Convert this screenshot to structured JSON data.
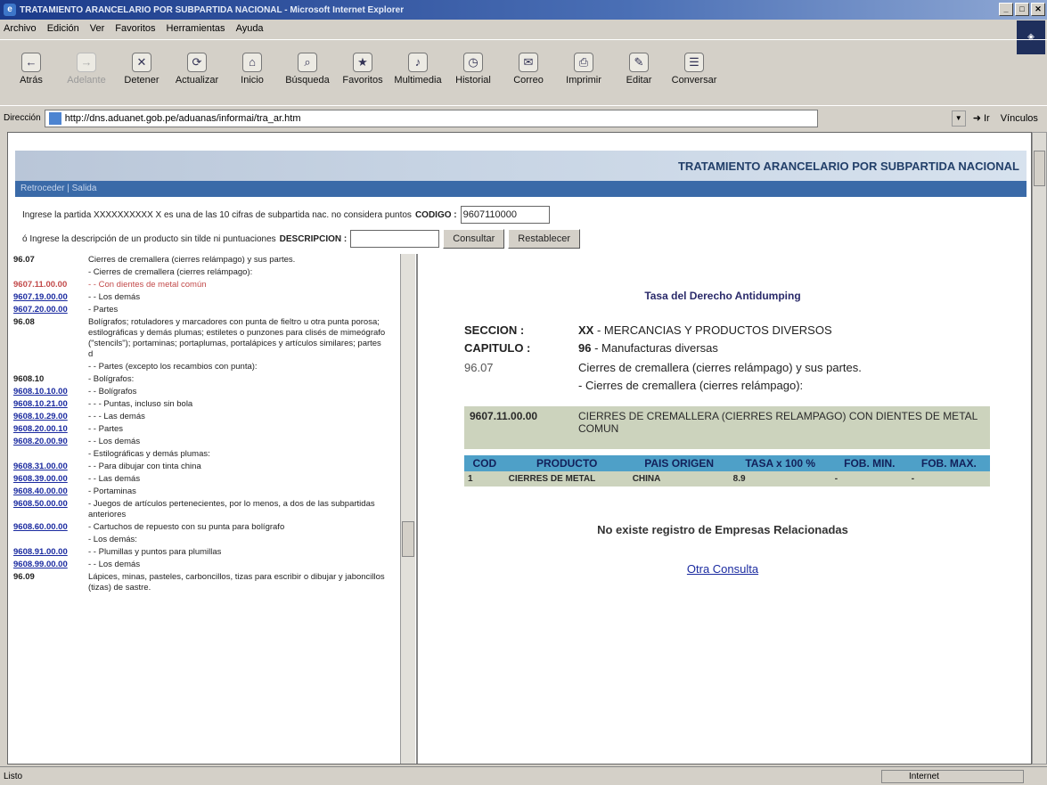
{
  "window": {
    "title": "TRATAMIENTO ARANCELARIO POR SUBPARTIDA NACIONAL - Microsoft Internet Explorer"
  },
  "menu": [
    "Archivo",
    "Edición",
    "Ver",
    "Favoritos",
    "Herramientas",
    "Ayuda"
  ],
  "toolbar": [
    {
      "label": "Atrás",
      "icon": "back-icon",
      "glyph": "←",
      "enabled": true
    },
    {
      "label": "Adelante",
      "icon": "forward-icon",
      "glyph": "→",
      "enabled": false
    },
    {
      "label": "Detener",
      "icon": "stop-icon",
      "glyph": "✕",
      "enabled": true
    },
    {
      "label": "Actualizar",
      "icon": "refresh-icon",
      "glyph": "⟳",
      "enabled": true
    },
    {
      "label": "Inicio",
      "icon": "home-icon",
      "glyph": "⌂",
      "enabled": true
    },
    {
      "label": "Búsqueda",
      "icon": "search-icon",
      "glyph": "⌕",
      "enabled": true
    },
    {
      "label": "Favoritos",
      "icon": "favorites-icon",
      "glyph": "★",
      "enabled": true
    },
    {
      "label": "Multimedia",
      "icon": "media-icon",
      "glyph": "♪",
      "enabled": true
    },
    {
      "label": "Historial",
      "icon": "history-icon",
      "glyph": "◷",
      "enabled": true
    },
    {
      "label": "Correo",
      "icon": "mail-icon",
      "glyph": "✉",
      "enabled": true
    },
    {
      "label": "Imprimir",
      "icon": "print-icon",
      "glyph": "⎙",
      "enabled": true
    },
    {
      "label": "Editar",
      "icon": "edit-icon",
      "glyph": "✎",
      "enabled": true
    },
    {
      "label": "Conversar",
      "icon": "discuss-icon",
      "glyph": "☰",
      "enabled": true
    }
  ],
  "address": {
    "label": "Dirección",
    "url": "http://dns.aduanet.gob.pe/aduanas/informai/tra_ar.htm",
    "go": "Ir",
    "links": "Vínculos"
  },
  "banner": {
    "title": "TRATAMIENTO ARANCELARIO POR SUBPARTIDA NACIONAL",
    "subnav": "Retroceder | Salida"
  },
  "form": {
    "row1_text": "Ingrese la partida XXXXXXXXXX X es una de las 10 cifras de subpartida nac. no considera puntos",
    "codigo_label": "CODIGO :",
    "codigo_value": "9607110000",
    "row2_text": "ó Ingrese la descripción de un producto sin tilde ni puntuaciones",
    "descripcion_label": "DESCRIPCION :",
    "descripcion_value": "",
    "consultar": "Consultar",
    "restablecer": "Restablecer"
  },
  "left_list": [
    {
      "code": "96.07",
      "desc": "Cierres de cremallera (cierres relámpago) y sus partes.",
      "style": "plain"
    },
    {
      "code": "",
      "desc": "- Cierres de cremallera (cierres relámpago):",
      "style": "plain"
    },
    {
      "code": "9607.11.00.00",
      "desc": "- - Con dientes de metal común",
      "style": "sel"
    },
    {
      "code": "9607.19.00.00",
      "desc": "- - Los demás",
      "style": "link"
    },
    {
      "code": "9607.20.00.00",
      "desc": "- Partes",
      "style": "link"
    },
    {
      "code": "96.08",
      "desc": "Bolígrafos; rotuladores y marcadores con punta de fieltro u otra punta porosa; estilográficas y demás plumas; estiletes o punzones para clisés de mimeógrafo (\"stencils\"); portaminas; portaplumas, portalápices y artículos similares; partes d",
      "style": "plain"
    },
    {
      "code": "",
      "desc": "- - Partes (excepto los recambios con punta):",
      "style": "plain"
    },
    {
      "code": "9608.10",
      "desc": "- Bolígrafos:",
      "style": "plain"
    },
    {
      "code": "9608.10.10.00",
      "desc": "- - Bolígrafos",
      "style": "link"
    },
    {
      "code": "9608.10.21.00",
      "desc": "- - - Puntas, incluso sin bola",
      "style": "link"
    },
    {
      "code": "9608.10.29.00",
      "desc": "- - - Las demás",
      "style": "link"
    },
    {
      "code": "9608.20.00.10",
      "desc": "- - Partes",
      "style": "link"
    },
    {
      "code": "9608.20.00.90",
      "desc": "- - Los demás",
      "style": "link"
    },
    {
      "code": "",
      "desc": "- Estilográficas y demás plumas:",
      "style": "plain"
    },
    {
      "code": "9608.31.00.00",
      "desc": "- - Para dibujar con tinta china",
      "style": "link"
    },
    {
      "code": "9608.39.00.00",
      "desc": "- - Las demás",
      "style": "link"
    },
    {
      "code": "9608.40.00.00",
      "desc": "- Portaminas",
      "style": "link"
    },
    {
      "code": "9608.50.00.00",
      "desc": "- Juegos de artículos pertenecientes, por lo menos, a dos de las subpartidas anteriores",
      "style": "link"
    },
    {
      "code": "9608.60.00.00",
      "desc": "- Cartuchos de repuesto con su punta para bolígrafo",
      "style": "link"
    },
    {
      "code": "",
      "desc": "- Los demás:",
      "style": "plain"
    },
    {
      "code": "9608.91.00.00",
      "desc": "- - Plumillas y puntos para plumillas",
      "style": "link"
    },
    {
      "code": "9608.99.00.00",
      "desc": "- - Los demás",
      "style": "link"
    },
    {
      "code": "96.09",
      "desc": "Lápices, minas, pasteles, carboncillos, tizas para escribir o dibujar y jaboncillos (tizas) de sastre.",
      "style": "plain"
    }
  ],
  "right": {
    "title": "Tasa del Derecho Antidumping",
    "seccion_label": "SECCION :",
    "seccion_code": "XX",
    "seccion_text": "- MERCANCIAS Y PRODUCTOS DIVERSOS",
    "capitulo_label": "CAPITULO :",
    "capitulo_code": "96",
    "capitulo_text": "- Manufacturas diversas",
    "partida_code": "96.07",
    "partida_text": "Cierres de cremallera (cierres relámpago) y sus partes.",
    "partida_sub": "- Cierres de cremallera (cierres relámpago):",
    "sub_code": "9607.11.00.00",
    "sub_text": "CIERRES DE CREMALLERA (CIERRES RELAMPAGO) CON DIENTES DE METAL COMUN",
    "table_headers": [
      "COD",
      "PRODUCTO",
      "PAIS ORIGEN",
      "TASA x 100 %",
      "FOB. MIN.",
      "FOB. MAX."
    ],
    "table_rows": [
      [
        "1",
        "CIERRES DE METAL",
        "CHINA",
        "8.9",
        "-",
        "-"
      ]
    ],
    "no_records": "No existe registro de Empresas Relacionadas",
    "otra": "Otra Consulta"
  },
  "status": {
    "left": "Listo",
    "zone": "Internet"
  }
}
